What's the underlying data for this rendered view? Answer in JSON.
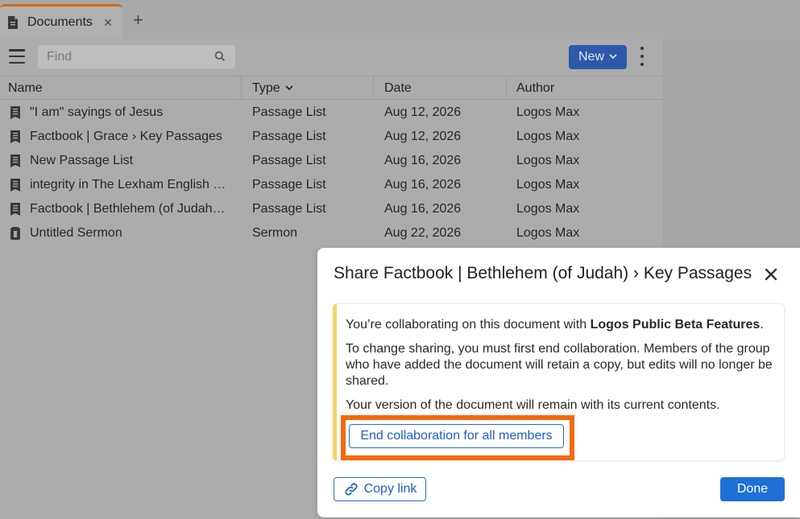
{
  "tabs": [
    {
      "label": "Documents",
      "icon": "document-icon",
      "active": true
    }
  ],
  "toolbar": {
    "find_placeholder": "Find",
    "new_label": "New"
  },
  "columns": {
    "name": "Name",
    "type": "Type",
    "date": "Date",
    "author": "Author"
  },
  "rows": [
    {
      "name": "\"I am\" sayings of Jesus",
      "type": "Passage List",
      "date": "Aug 12, 2026",
      "author": "Logos Max",
      "icon": "passage-list-icon"
    },
    {
      "name": "Factbook | Grace › Key Passages",
      "type": "Passage List",
      "date": "Aug 12, 2026",
      "author": "Logos Max",
      "icon": "passage-list-icon"
    },
    {
      "name": "New Passage List",
      "type": "Passage List",
      "date": "Aug 16, 2026",
      "author": "Logos Max",
      "icon": "passage-list-icon"
    },
    {
      "name": "integrity in The Lexham English …",
      "type": "Passage List",
      "date": "Aug 16, 2026",
      "author": "Logos Max",
      "icon": "passage-list-icon"
    },
    {
      "name": "Factbook | Bethlehem (of Judah…",
      "type": "Passage List",
      "date": "Aug 16, 2026",
      "author": "Logos Max",
      "icon": "passage-list-icon"
    },
    {
      "name": "Untitled Sermon",
      "type": "Sermon",
      "date": "Aug 22, 2026",
      "author": "Logos Max",
      "icon": "sermon-icon"
    }
  ],
  "dialog": {
    "title": "Share Factbook | Bethlehem (of Judah) › Key Passages",
    "notice": {
      "p1_prefix": "You’re collaborating on this document with ",
      "p1_group": "Logos Public Beta Features",
      "p1_suffix": ".",
      "p2": "To change sharing, you must first end collaboration. Members of the group who have added the document will retain a copy, but edits will no longer be shared.",
      "p3": "Your version of the document will remain with its current contents.",
      "end_button": "End collaboration for all members"
    },
    "copy_link": "Copy link",
    "done": "Done"
  },
  "colors": {
    "accent": "#1f6fd6",
    "highlight": "#f26a10",
    "notice_bar": "#f3d36b",
    "tab_accent": "#d76a1b"
  }
}
